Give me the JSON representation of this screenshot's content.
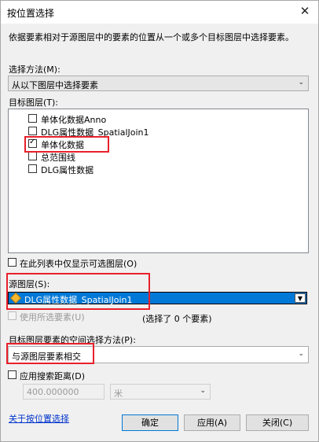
{
  "window": {
    "title": "按位置选择",
    "close_glyph": "✕"
  },
  "description": "依据要素相对于源图层中的要素的位置从一个或多个目标图层中选择要素。",
  "selection_method": {
    "label": "选择方法(M):",
    "value": "从以下图层中选择要素"
  },
  "target_layers": {
    "label": "目标图层(T):",
    "items": [
      {
        "label": "单体化数据Anno",
        "checked": false
      },
      {
        "label": "DLG属性数据_SpatialJoin1",
        "checked": false
      },
      {
        "label": "单体化数据",
        "checked": true
      },
      {
        "label": "总范围线",
        "checked": false
      },
      {
        "label": "DLG属性数据",
        "checked": false
      }
    ]
  },
  "only_selectable": {
    "label": "在此列表中仅显示可选图层(O)",
    "checked": false
  },
  "source_layer": {
    "label": "源图层(S):",
    "value": "DLG属性数据_SpatialJoin1",
    "icon": "feature-layer-icon"
  },
  "use_selected": {
    "label": "使用所选要素(U)",
    "checked": false,
    "count_text": "(选择了 0 个要素)"
  },
  "spatial_method": {
    "label": "目标图层要素的空间选择方法(P):",
    "value": "与源图层要素相交"
  },
  "search_distance": {
    "label": "应用搜索距离(D)",
    "checked": false,
    "value": "400.000000",
    "unit": "米"
  },
  "footer": {
    "help_link": "关于按位置选择",
    "ok": "确定",
    "apply": "应用(A)",
    "close": "关闭(C)"
  },
  "colors": {
    "highlight_box": "#e8202a",
    "selection": "#0078d7",
    "link": "#0033cc"
  }
}
